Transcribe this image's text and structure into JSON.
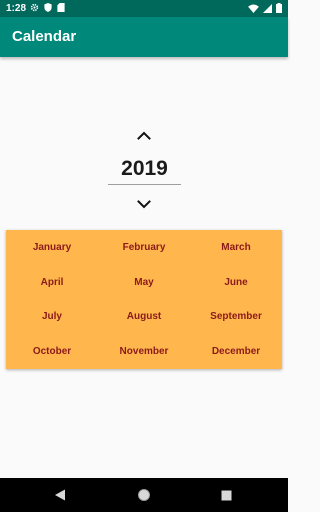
{
  "status_bar": {
    "time": "1:28",
    "icons_left": [
      "gear-icon",
      "shield-icon",
      "sd-card-icon"
    ],
    "icons_right": [
      "wifi-icon",
      "signal-icon",
      "battery-icon"
    ]
  },
  "app_bar": {
    "title": "Calendar",
    "color": "#00897b"
  },
  "year_picker": {
    "year": "2019",
    "up_icon": "chevron-up-icon",
    "down_icon": "chevron-down-icon"
  },
  "months": {
    "panel_color": "#ffb74d",
    "text_color": "#8b1a1a",
    "items": [
      "January",
      "February",
      "March",
      "April",
      "May",
      "June",
      "July",
      "August",
      "September",
      "October",
      "November",
      "December"
    ]
  },
  "nav_bar": {
    "icons": [
      "back-icon",
      "home-icon",
      "recents-icon"
    ]
  }
}
